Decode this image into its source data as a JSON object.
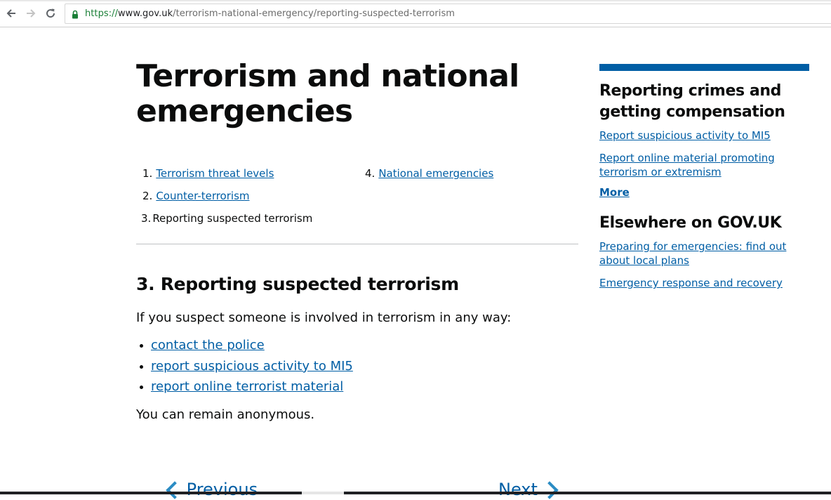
{
  "browser": {
    "url_scheme": "https://",
    "url_host": "www.gov.uk",
    "url_path": "/terrorism-national-emergency/reporting-suspected-terrorism",
    "icons": [
      "back-arrow-icon",
      "forward-arrow-icon",
      "reload-icon",
      "lock-icon"
    ],
    "secure_color": "#1a7f37"
  },
  "page": {
    "title": "Terrorism and national emergencies",
    "parts": [
      {
        "num": "1.",
        "label": "Terrorism threat levels",
        "current": false
      },
      {
        "num": "2.",
        "label": "Counter-terrorism",
        "current": false
      },
      {
        "num": "3.",
        "label": "Reporting suspected terrorism",
        "current": true
      },
      {
        "num": "4.",
        "label": "National emergencies",
        "current": false
      }
    ],
    "section_heading": "3. Reporting suspected terrorism",
    "intro": "If you suspect someone is involved in terrorism in any way:",
    "links": [
      "contact the police",
      "report suspicious activity to MI5",
      "report online terrorist material"
    ],
    "outro": "You can remain anonymous.",
    "pagination": {
      "previous": "Previous",
      "next": "Next"
    }
  },
  "sidebar": {
    "accent_color": "#005ea5",
    "heading1": "Reporting crimes and getting compensation",
    "links1": [
      "Report suspicious activity to MI5",
      "Report online material promoting terrorism or extremism"
    ],
    "more": "More",
    "heading2": "Elsewhere on GOV.UK",
    "links2": [
      "Preparing for emergencies: find out about local plans",
      "Emergency response and recovery"
    ]
  }
}
